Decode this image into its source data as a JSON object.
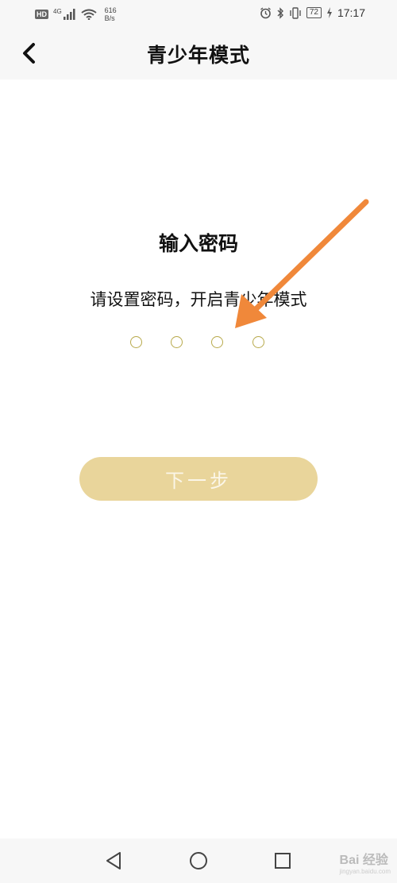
{
  "status_bar": {
    "hd_label": "HD",
    "network_label": "4G",
    "net_speed_value": "616",
    "net_speed_unit": "B/s",
    "battery_level": "72",
    "time": "17:17"
  },
  "header": {
    "back_icon": "chevron-left-icon",
    "title": "青少年模式"
  },
  "main": {
    "heading": "输入密码",
    "subtitle": "请设置密码，开启青少年模式",
    "pin_length": 4,
    "pin_filled": 0,
    "pin_color": "#b7a94a",
    "next_button_label": "下一步",
    "next_button_color": "#e9d59b"
  },
  "annotation": {
    "arrow_color": "#f0883a"
  },
  "system_nav": {
    "back_icon": "triangle-back-icon",
    "home_icon": "circle-home-icon",
    "recents_icon": "square-recents-icon"
  },
  "watermark": {
    "text": "Bai 经验",
    "subtext": "jingyan.baidu.com"
  }
}
